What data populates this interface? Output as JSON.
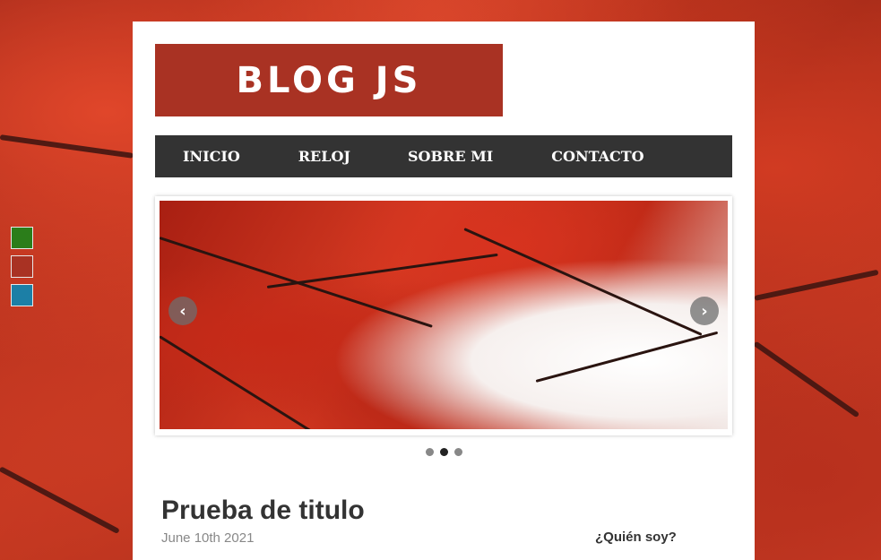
{
  "site": {
    "logo_text": "BLOG JS"
  },
  "nav": {
    "items": [
      {
        "label": "INICIO"
      },
      {
        "label": "RELOJ"
      },
      {
        "label": "SOBRE MI"
      },
      {
        "label": "CONTACTO"
      }
    ]
  },
  "theme_switcher": {
    "colors": [
      "#2b7d1a",
      "#a93223",
      "#1c7fa6"
    ]
  },
  "slider": {
    "prev_icon": "chevron-left-icon",
    "next_icon": "chevron-right-icon",
    "prev_glyph": "‹",
    "next_glyph": "›",
    "slide_count": 3,
    "active_slide": 2
  },
  "post": {
    "title": "Prueba de titulo",
    "date": "June 10th 2021",
    "excerpt": ""
  },
  "sidebar": {
    "title": "¿Quién soy?"
  },
  "colors": {
    "accent": "#a93223",
    "nav_bg": "#333333"
  }
}
